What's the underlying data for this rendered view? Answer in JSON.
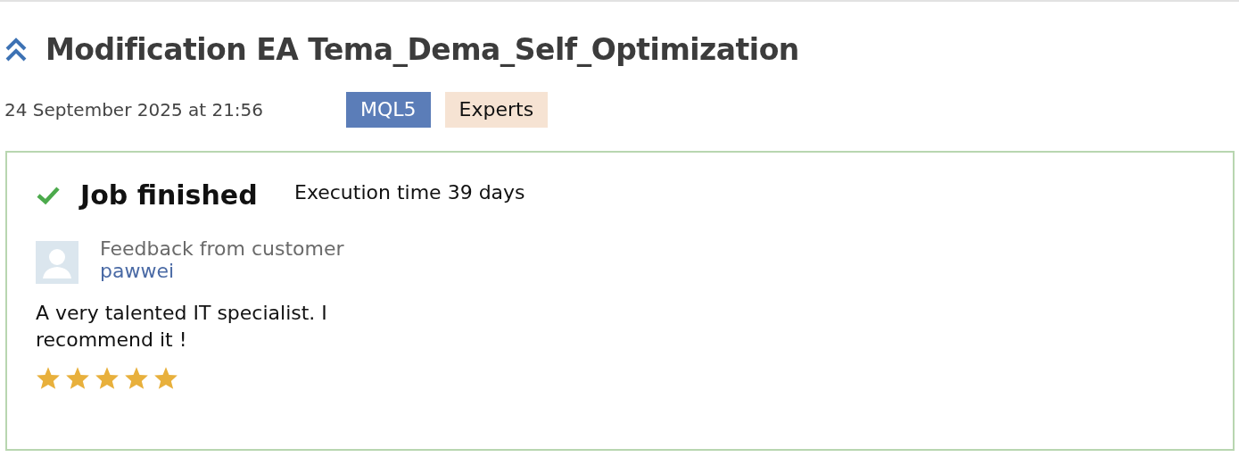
{
  "title": "Modification EA Tema_Dema_Self_Optimization",
  "date": "24 September 2025 at 21:56",
  "tags": [
    {
      "label": "MQL5",
      "kind": "platform"
    },
    {
      "label": "Experts",
      "kind": "category"
    }
  ],
  "job": {
    "status": "Job finished",
    "done": true,
    "execution_time": "Execution time 39 days",
    "feedback_label": "Feedback from customer",
    "customer": "pawwei",
    "review": "A very talented IT specialist. I recommend it !",
    "stars": 5
  }
}
